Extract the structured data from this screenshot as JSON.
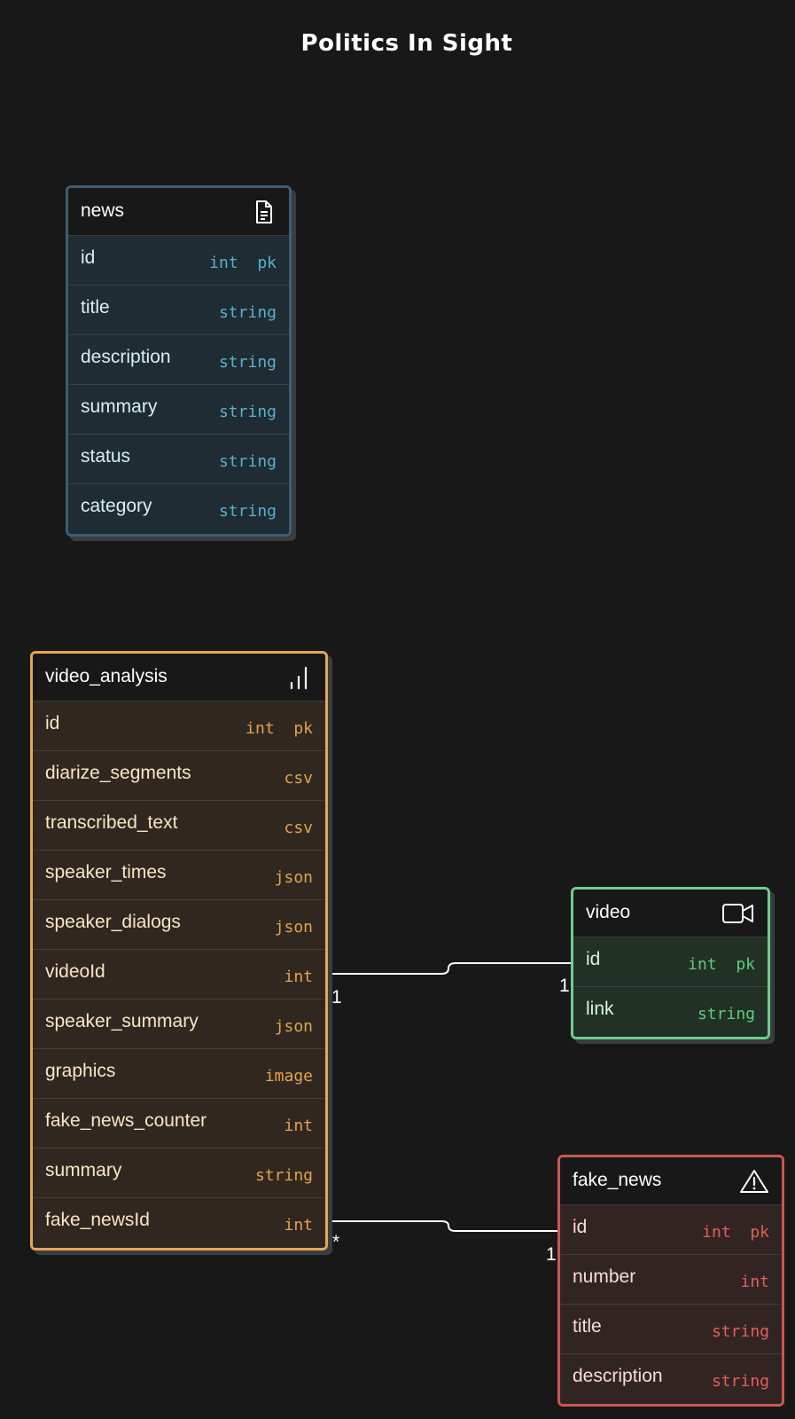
{
  "title": "Politics In Sight",
  "tables": {
    "news": {
      "name": "news",
      "icon": "document-icon",
      "color": "#3e5e72",
      "body_bg": "#1f2c33",
      "text_color": "#d8eef6",
      "type_color": "#5aafd1",
      "columns": [
        {
          "name": "id",
          "type": "int  pk"
        },
        {
          "name": "title",
          "type": "string"
        },
        {
          "name": "description",
          "type": "string"
        },
        {
          "name": "summary",
          "type": "string"
        },
        {
          "name": "status",
          "type": "string"
        },
        {
          "name": "category",
          "type": "string"
        }
      ]
    },
    "video_analysis": {
      "name": "video_analysis",
      "icon": "bar-chart-icon",
      "color": "#e6a653",
      "body_bg": "#302820",
      "text_color": "#f8e6c6",
      "type_color": "#e3a24a",
      "columns": [
        {
          "name": "id",
          "type": "int  pk"
        },
        {
          "name": "diarize_segments",
          "type": "csv"
        },
        {
          "name": "transcribed_text",
          "type": "csv"
        },
        {
          "name": "speaker_times",
          "type": "json"
        },
        {
          "name": "speaker_dialogs",
          "type": "json"
        },
        {
          "name": "videoId",
          "type": "int"
        },
        {
          "name": "speaker_summary",
          "type": "json"
        },
        {
          "name": "graphics",
          "type": "image"
        },
        {
          "name": "fake_news_counter",
          "type": "int"
        },
        {
          "name": "summary",
          "type": "string"
        },
        {
          "name": "fake_newsId",
          "type": "int"
        }
      ]
    },
    "video": {
      "name": "video",
      "icon": "video-camera-icon",
      "color": "#6dd08a",
      "body_bg": "#213126",
      "text_color": "#d9f5e0",
      "type_color": "#5fcc7c",
      "columns": [
        {
          "name": "id",
          "type": "int  pk"
        },
        {
          "name": "link",
          "type": "string"
        }
      ]
    },
    "fake_news": {
      "name": "fake_news",
      "icon": "warning-icon",
      "color": "#c9574f",
      "body_bg": "#332424",
      "text_color": "#f6dcda",
      "type_color": "#df605a",
      "columns": [
        {
          "name": "id",
          "type": "int  pk"
        },
        {
          "name": "number",
          "type": "int"
        },
        {
          "name": "title",
          "type": "string"
        },
        {
          "name": "description",
          "type": "string"
        }
      ]
    }
  },
  "relations": [
    {
      "from": "video_analysis.videoId",
      "to": "video.id",
      "from_card": "1",
      "to_card": "1"
    },
    {
      "from": "video_analysis.fake_newsId",
      "to": "fake_news.id",
      "from_card": "*",
      "to_card": "1"
    }
  ]
}
